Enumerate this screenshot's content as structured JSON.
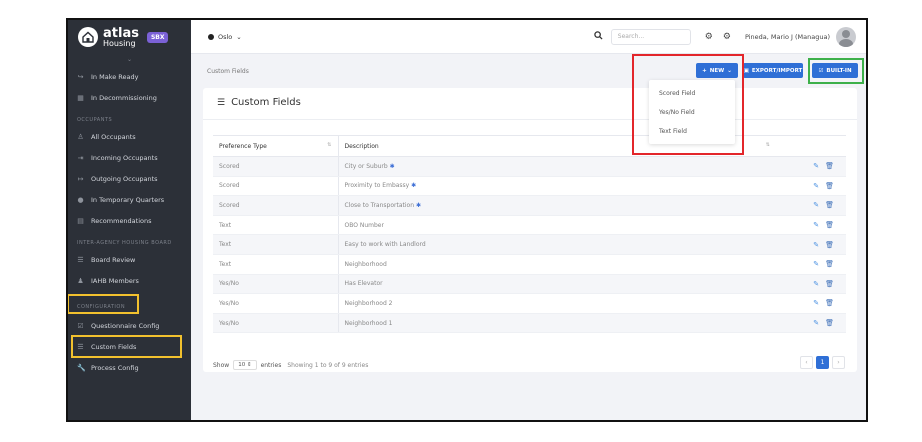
{
  "brand": {
    "name": "atlas",
    "sub": "Housing",
    "badge": "SBX"
  },
  "sidebar": {
    "collapse_icon": "chevron-down-icon",
    "top_items": [
      {
        "label": "In Make Ready",
        "icon": "redo-arrow-icon"
      },
      {
        "label": "In Decommissioning",
        "icon": "calendar-icon"
      }
    ],
    "sections": [
      {
        "label": "OCCUPANTS",
        "items": [
          {
            "label": "All Occupants",
            "icon": "person-icon"
          },
          {
            "label": "Incoming Occupants",
            "icon": "sign-in-icon"
          },
          {
            "label": "Outgoing Occupants",
            "icon": "sign-out-icon"
          },
          {
            "label": "In Temporary Quarters",
            "icon": "circle-icon"
          },
          {
            "label": "Recommendations",
            "icon": "clipboard-icon"
          }
        ]
      },
      {
        "label": "INTER-AGENCY HOUSING BOARD",
        "items": [
          {
            "label": "Board Review",
            "icon": "list-icon"
          },
          {
            "label": "IAHB Members",
            "icon": "users-icon"
          }
        ]
      },
      {
        "label": "CONFIGURATION",
        "items": [
          {
            "label": "Questionnaire Config",
            "icon": "checkbox-icon"
          },
          {
            "label": "Custom Fields",
            "icon": "list-icon"
          },
          {
            "label": "Process Config",
            "icon": "wrench-icon"
          }
        ]
      }
    ]
  },
  "topbar": {
    "location": "Oslo",
    "search_placeholder": "Search...",
    "user": "Pineda, Mario J (Managua)"
  },
  "breadcrumb": "Custom Fields",
  "buttons": {
    "new": "NEW",
    "export": "EXPORT/IMPORT",
    "builtin": "BUILT-IN"
  },
  "dropdown": [
    "Scored Field",
    "Yes/No Field",
    "Text Field"
  ],
  "card": {
    "title": "Custom Fields"
  },
  "table": {
    "headers": [
      "Preference Type",
      "Description"
    ],
    "rows": [
      {
        "type": "Scored",
        "desc": "City or Suburb",
        "star": true
      },
      {
        "type": "Scored",
        "desc": "Proximity to Embassy",
        "star": true
      },
      {
        "type": "Scored",
        "desc": "Close to Transportation",
        "star": true
      },
      {
        "type": "Text",
        "desc": "OBO Number",
        "star": false
      },
      {
        "type": "Text",
        "desc": "Easy to work with Landlord",
        "star": false
      },
      {
        "type": "Text",
        "desc": "Neighborhood",
        "star": false
      },
      {
        "type": "Yes/No",
        "desc": "Has Elevator",
        "star": false
      },
      {
        "type": "Yes/No",
        "desc": "Neighborhood 2",
        "star": false
      },
      {
        "type": "Yes/No",
        "desc": "Neighborhood 1",
        "star": false
      }
    ]
  },
  "footer": {
    "show": "Show",
    "page_size": "10",
    "entries": "entries",
    "summary": "Showing 1 to 9 of 9 entries",
    "page": "1"
  },
  "colors": {
    "sidebar": "#2c3038",
    "primary": "#2f6fd6",
    "highlight_red": "#e3262b",
    "highlight_green": "#3db04a",
    "highlight_yellow": "#f2c12e"
  }
}
